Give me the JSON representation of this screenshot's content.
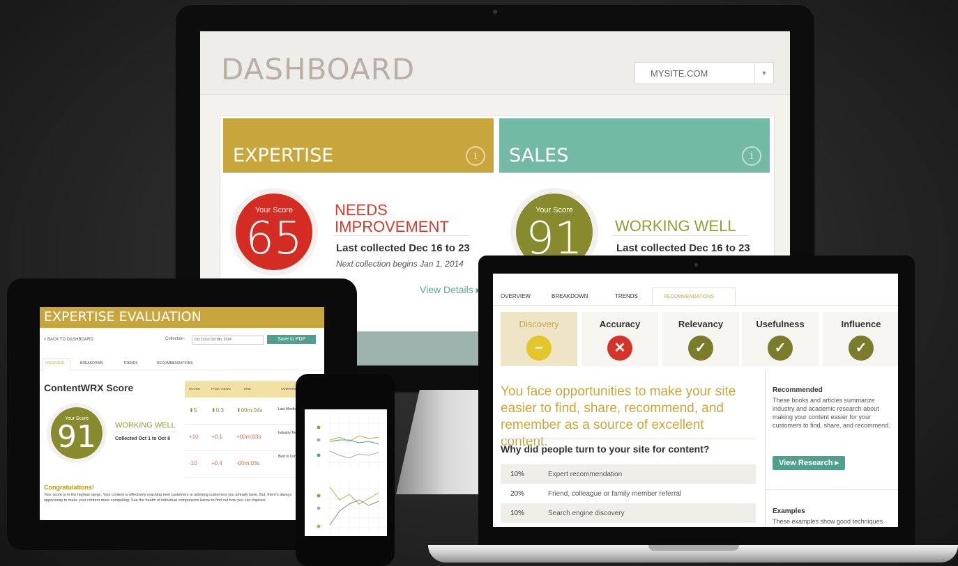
{
  "dashboard": {
    "title": "DASHBOARD",
    "site_select": "MYSITE.COM",
    "expertise": {
      "title": "EXPERTISE",
      "score_label": "Your Score",
      "score": "65",
      "status_line1": "NEEDS",
      "status_line2": "IMPROVEMENT",
      "collected": "Last collected Dec 16 to 23",
      "next": "Next collection begins Jan 1, 2014",
      "view_details": "View Details ▸"
    },
    "sales": {
      "title": "SALES",
      "score_label": "Your Score",
      "score": "91",
      "status": "WORKING WELL",
      "collected": "Last collected Dec 16 to 23"
    }
  },
  "tablet": {
    "title": "EXPERTISE EVALUATION",
    "back": "« BACK TO DASHBOARD",
    "collection_label": "Collection:",
    "collection_value": "Oct 1st to Oct 8th, 2014",
    "save_pdf": "Save to PDF",
    "tabs": [
      "OVERVIEW",
      "BREAKDOWN",
      "TRENDS",
      "RECOMMENDATIONS"
    ],
    "score_heading": "ContentWRX Score",
    "score_label": "Your Score",
    "score": "91",
    "status": "WORKING WELL",
    "collected": "Collected Oct 1 to Oct 8",
    "grid_headers": [
      "SCORE",
      "PAGE VIEWS",
      "TIME",
      "COMPARE"
    ],
    "rows": [
      [
        "⬆5",
        "⬆0.3",
        "⬆00m:04s",
        "Last Month"
      ],
      [
        "+10",
        "+0.1",
        "+00m:03s",
        "Industry Technology"
      ],
      [
        "-10",
        "+0.4",
        "-00m:03s",
        "Best in Content Business"
      ]
    ],
    "congrats": "Congratulations!",
    "paragraph": "Your score is in the highest range. Your content is effectively reaching new customers or advising customers you already have. But, there's always opportunity to make your content more compelling. See the health of individual components below to find out how you can improve."
  },
  "laptop": {
    "tabs": [
      "OVERVIEW",
      "BREAKDOWN",
      "TRENDS",
      "RECOMMENDATIONS"
    ],
    "categories": [
      {
        "label": "Discovery",
        "icon": "minus-icon",
        "color": "#e3c62a"
      },
      {
        "label": "Accuracy",
        "icon": "x-icon",
        "color": "#d5332a"
      },
      {
        "label": "Relevancy",
        "icon": "check-icon",
        "color": "#7a7c2b"
      },
      {
        "label": "Usefulness",
        "icon": "check-icon",
        "color": "#7a7c2b"
      },
      {
        "label": "Influence",
        "icon": "check-icon",
        "color": "#7a7c2b"
      }
    ],
    "headline": "You face opportunities to make your site easier to find, share, recommend, and remember as a source of excellent content.",
    "question": "Why did people turn to your site for content?",
    "reasons": [
      {
        "pct": "10%",
        "label": "Expert recommendation"
      },
      {
        "pct": "20%",
        "label": "Friend, colleague or family member referral"
      },
      {
        "pct": "10%",
        "label": "Search engine discovery"
      }
    ],
    "recommended_heading": "Recommended",
    "recommended_text": "These books and articles summarize industry and academic research about making your content easier for your customers to find, share, and recommend.",
    "view_research": "View Research ▸",
    "examples_heading": "Examples",
    "examples_text": "These examples show good techniques"
  },
  "colors": {
    "gold": "#c9a63b",
    "teal": "#72b9a6",
    "red": "#d73a2c",
    "olive": "#888a2e"
  }
}
